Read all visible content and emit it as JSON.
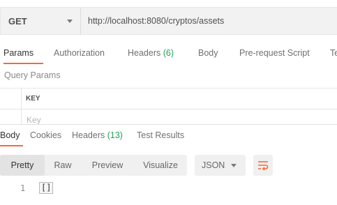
{
  "request": {
    "method": "GET",
    "url": "http://localhost:8080/cryptos/assets"
  },
  "request_tabs": [
    {
      "label": "Params",
      "count": "",
      "active": true
    },
    {
      "label": "Authorization",
      "count": "",
      "active": false
    },
    {
      "label": "Headers",
      "count": "(6)",
      "active": false
    },
    {
      "label": "Body",
      "count": "",
      "active": false
    },
    {
      "label": "Pre-request Script",
      "count": "",
      "active": false
    },
    {
      "label": "Te",
      "count": "",
      "active": false
    }
  ],
  "query_params": {
    "title": "Query Params",
    "column_key": "KEY",
    "key_placeholder": "Key"
  },
  "response_tabs": [
    {
      "label": "Body",
      "count": "",
      "active": true
    },
    {
      "label": "Cookies",
      "count": "",
      "active": false
    },
    {
      "label": "Headers",
      "count": "(13)",
      "active": false
    },
    {
      "label": "Test Results",
      "count": "",
      "active": false
    }
  ],
  "view_modes": [
    {
      "label": "Pretty",
      "active": true
    },
    {
      "label": "Raw",
      "active": false
    },
    {
      "label": "Preview",
      "active": false
    },
    {
      "label": "Visualize",
      "active": false
    }
  ],
  "format_select": {
    "value": "JSON"
  },
  "wrap_icon": "wrap-lines-icon",
  "response_body": {
    "line_number": "1",
    "text": "[]"
  },
  "colors": {
    "accent": "#f26b3a",
    "count_green": "#26a35b"
  }
}
